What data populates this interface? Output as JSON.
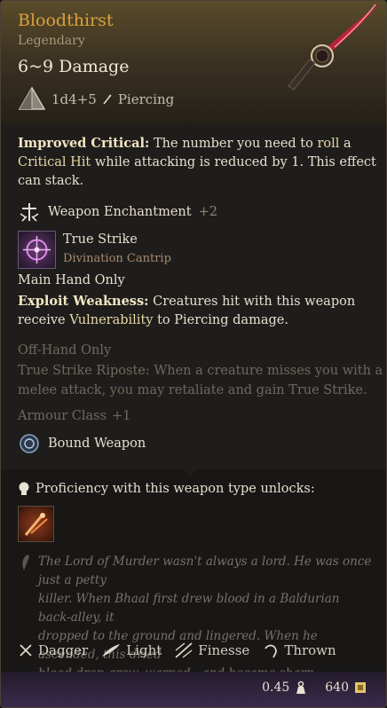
{
  "item": {
    "name": "Bloodthirst",
    "rarity": "Legendary",
    "damage": "6~9 Damage",
    "dice": "1d4+5",
    "damage_type": "Piercing"
  },
  "improved_critical": {
    "label": "Improved Critical:",
    "text_1": "The number you need to",
    "roll": "roll",
    "text_2": "a",
    "critical_hit": "Critical Hit",
    "text_3": "while attacking is reduced by 1. This effect",
    "text_4": "can stack."
  },
  "enchantment": {
    "label": "Weapon Enchantment",
    "value": "+2"
  },
  "spell": {
    "name": "True Strike",
    "school": "Divination Cantrip"
  },
  "main_hand": {
    "heading": "Main Hand Only",
    "label": "Exploit Weakness:",
    "text_1": "Creatures hit with this weapon",
    "text_2": "receive",
    "vulnerability": "Vulnerability",
    "text_3": "to Piercing damage."
  },
  "off_hand": {
    "heading": "Off-Hand Only",
    "line_1": "True Strike Riposte: When a creature misses you with a",
    "line_2": "melee attack, you may retaliate and gain True Strike."
  },
  "armour": {
    "label": "Armour Class",
    "value": "+1"
  },
  "bound": {
    "label": "Bound Weapon"
  },
  "proficiency": {
    "label": "Proficiency with this weapon type unlocks:"
  },
  "lore": [
    "The Lord of Murder wasn't always a lord. He was once just a petty",
    "killer. When Bhaal first drew blood in a Baldurian back-alley, it",
    "dropped to the ground and lingered. When he ascended, this dried",
    "blood-drop grew, warped - and became sharp."
  ],
  "properties": [
    {
      "label": "Dagger",
      "icon": "dagger-icon"
    },
    {
      "label": "Light",
      "icon": "feather-icon"
    },
    {
      "label": "Finesse",
      "icon": "finesse-icon"
    },
    {
      "label": "Thrown",
      "icon": "thrown-icon"
    }
  ],
  "footer": {
    "weight": "0.45",
    "value": "640"
  },
  "colors": {
    "name": "#d9a13a",
    "highlight": "#e6d9a6",
    "footer": "#3a2b4d"
  }
}
